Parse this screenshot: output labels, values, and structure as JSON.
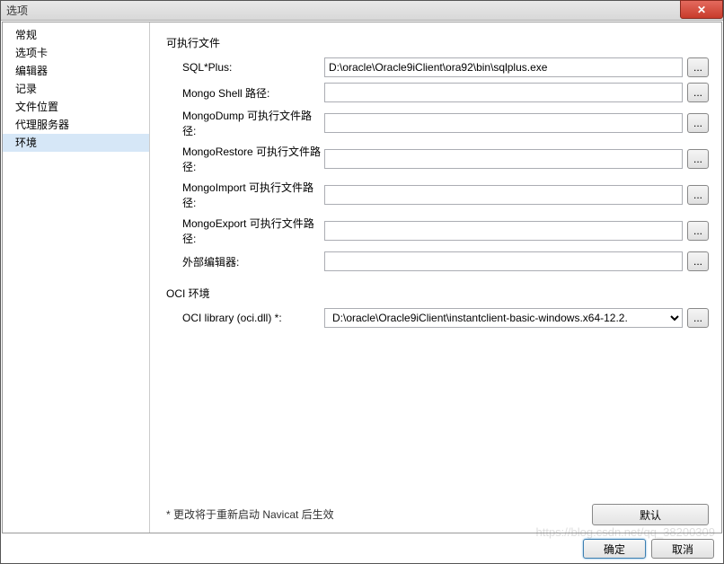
{
  "window": {
    "title": "选项",
    "close_glyph": "✕"
  },
  "sidebar": {
    "items": [
      {
        "label": "常规"
      },
      {
        "label": "选项卡"
      },
      {
        "label": "编辑器"
      },
      {
        "label": "记录"
      },
      {
        "label": "文件位置"
      },
      {
        "label": "代理服务器"
      },
      {
        "label": "环境"
      }
    ],
    "selected_index": 6
  },
  "sections": {
    "exec_title": "可执行文件",
    "oci_title": "OCI 环境"
  },
  "fields": {
    "sqlplus": {
      "label": "SQL*Plus:",
      "value": "D:\\oracle\\Oracle9iClient\\ora92\\bin\\sqlplus.exe"
    },
    "mongo_shell": {
      "label": "Mongo Shell 路径:",
      "value": ""
    },
    "mongodump": {
      "label": "MongoDump 可执行文件路径:",
      "value": ""
    },
    "mongorestore": {
      "label": "MongoRestore 可执行文件路径:",
      "value": ""
    },
    "mongoimport": {
      "label": "MongoImport 可执行文件路径:",
      "value": ""
    },
    "mongoexport": {
      "label": "MongoExport 可执行文件路径:",
      "value": ""
    },
    "external_editor": {
      "label": "外部编辑器:",
      "value": ""
    },
    "oci_library": {
      "label": "OCI library (oci.dll) *:",
      "value": "D:\\oracle\\Oracle9iClient\\instantclient-basic-windows.x64-12.2."
    }
  },
  "browse_glyph": "...",
  "footnote": "* 更改将于重新启动 Navicat 后生效",
  "buttons": {
    "default": "默认",
    "ok": "确定",
    "cancel": "取消"
  },
  "watermark": "https://blog.csdn.net/qq_38200309"
}
